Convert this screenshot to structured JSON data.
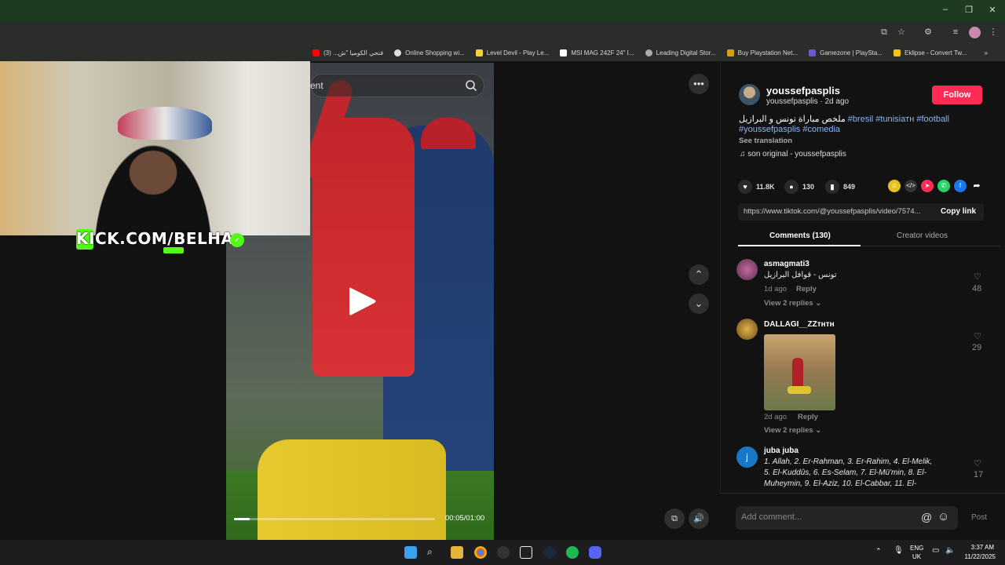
{
  "bookmarks": [
    {
      "label": "فتحي الكوميا \"ش... (3)",
      "icon_color": "#ff0000"
    },
    {
      "label": "Online Shopping wi...",
      "icon_color": "#dddddd"
    },
    {
      "label": "Level Devil - Play Le...",
      "icon_color": "#f4d03f"
    },
    {
      "label": "MSI MAG 242F 24\" I...",
      "icon_color": "#222222"
    },
    {
      "label": "Leading Digital Stor...",
      "icon_color": "#aaaaaa"
    },
    {
      "label": "Buy Playstation Net...",
      "icon_color": "#d4a017"
    },
    {
      "label": "Gamezone | PlaySta...",
      "icon_color": "#6a5acd"
    },
    {
      "label": "Eklipse - Convert Tw...",
      "icon_color": "#f1c40f"
    }
  ],
  "stream": {
    "kick_text": "KICK.COM/BELHA"
  },
  "video": {
    "search_text": "ent",
    "time": "00:05/01:00",
    "progress": 0.08
  },
  "post": {
    "username": "youssefpasplis",
    "sub": "youssefpasplis · 2d ago",
    "follow_label": "Follow",
    "caption_ar": "ملخص مباراة تونس و البرازيل",
    "tag1": "#bresil",
    "tag2": "#tunisiaтн",
    "tag3": "#football",
    "tag4": "#youssefpasplis",
    "tag5": "#comedia",
    "see_translation": "See translation",
    "sound": "son original - youssefpasplis",
    "likes": "11.8K",
    "comments": "130",
    "saves": "849",
    "link": "https://www.tiktok.com/@youssefpasplis/video/7574...",
    "copy_link": "Copy link",
    "tab_comments": "Comments (130)",
    "tab_creator": "Creator videos"
  },
  "comments": [
    {
      "name": "asmagmati3",
      "text": "تونس - قوافل البرازيل",
      "time": "1d ago",
      "reply": "Reply",
      "replies": "View 2 replies",
      "likes": "48"
    },
    {
      "name": "DALLAGI__ZZтнтн",
      "time": "2d ago",
      "reply": "Reply",
      "replies": "View 2 replies",
      "likes": "29"
    },
    {
      "name": "juba juba",
      "line1": "1. Allah, 2. Er-Rahman, 3. Er-Rahim, 4. El-Melik,",
      "line2": "5. El-Kuddûs, 6. Es-Selam, 7. El-Mü'min, 8. El-",
      "line3": "Muheymin, 9. El-Aziz, 10. El-Cabbar, 11. El-",
      "likes": "17",
      "avatar_letter": "j"
    }
  ],
  "comment_input": {
    "placeholder": "Add comment...",
    "post": "Post"
  },
  "taskbar": {
    "lang1": "ENG",
    "lang2": "UK",
    "time": "3:37 AM",
    "date": "11/22/2025"
  }
}
